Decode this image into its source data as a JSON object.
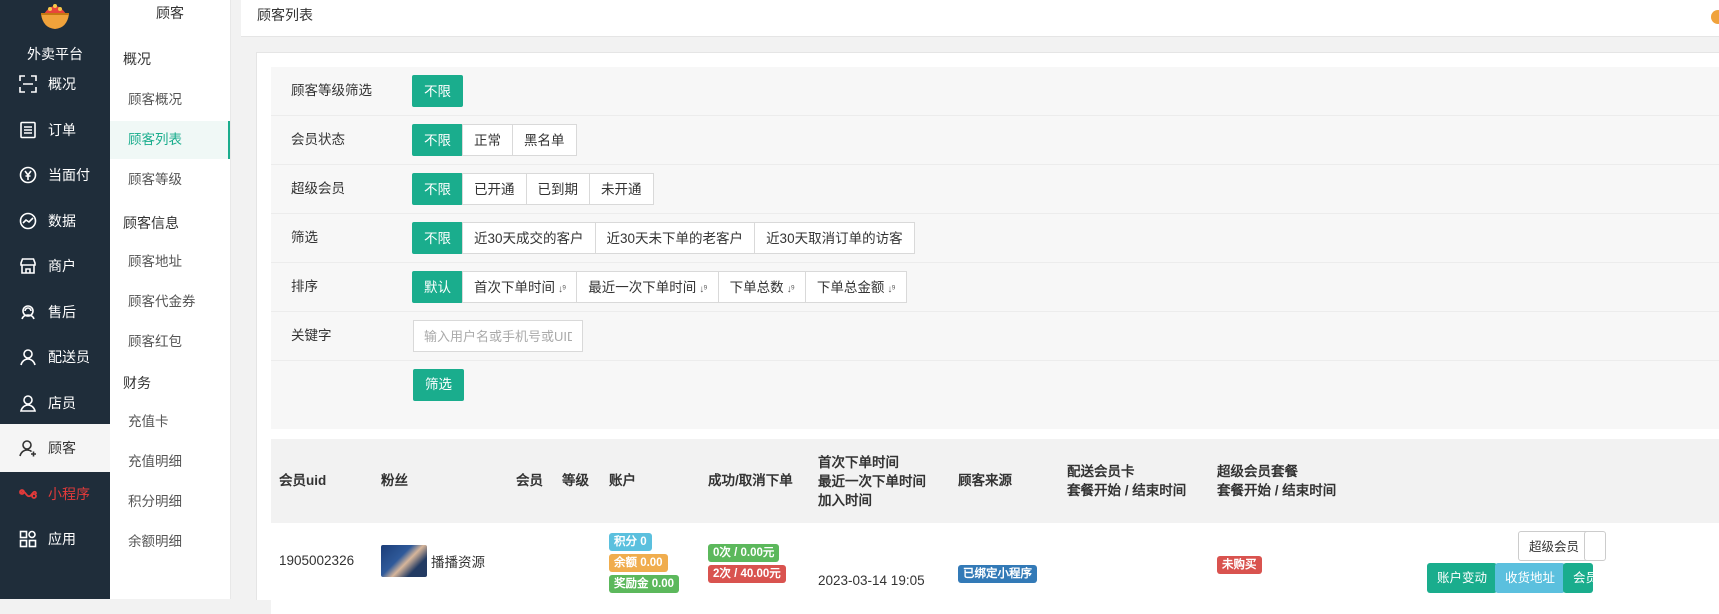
{
  "brand": {
    "name": "外卖平台"
  },
  "nav": [
    {
      "label": "概况",
      "icon": "overview-icon"
    },
    {
      "label": "订单",
      "icon": "order-icon"
    },
    {
      "label": "当面付",
      "icon": "yen-icon"
    },
    {
      "label": "数据",
      "icon": "chart-icon"
    },
    {
      "label": "商户",
      "icon": "store-icon"
    },
    {
      "label": "售后",
      "icon": "support-icon"
    },
    {
      "label": "配送员",
      "icon": "courier-icon"
    },
    {
      "label": "店员",
      "icon": "clerk-icon"
    },
    {
      "label": "顾客",
      "icon": "customer-icon"
    },
    {
      "label": "小程序",
      "icon": "miniprogram-icon"
    },
    {
      "label": "应用",
      "icon": "apps-icon"
    }
  ],
  "sub": {
    "title": "顾客",
    "groups": [
      "概况",
      "顾客信息",
      "财务"
    ],
    "items": [
      "顾客概况",
      "顾客列表",
      "顾客等级",
      "顾客地址",
      "顾客代金券",
      "顾客红包",
      "充值卡",
      "充值明细",
      "积分明细",
      "余额明细"
    ]
  },
  "topbar": {
    "title": "顾客列表"
  },
  "filters": {
    "level": {
      "label": "顾客等级筛选",
      "options": [
        "不限"
      ]
    },
    "status": {
      "label": "会员状态",
      "options": [
        "不限",
        "正常",
        "黑名单"
      ]
    },
    "super": {
      "label": "超级会员",
      "options": [
        "不限",
        "已开通",
        "已到期",
        "未开通"
      ]
    },
    "screen": {
      "label": "筛选",
      "options": [
        "不限",
        "近30天成交的客户",
        "近30天未下单的老客户",
        "近30天取消订单的访客"
      ]
    },
    "sort": {
      "label": "排序",
      "options": [
        "默认",
        "首次下单时间",
        "最近一次下单时间",
        "下单总数",
        "下单总金额"
      ]
    },
    "keyword": {
      "label": "关键字",
      "placeholder": "输入用户名或手机号或UID"
    },
    "submit": "筛选"
  },
  "table": {
    "headers": {
      "uid": "会员uid",
      "fans": "粉丝",
      "member": "会员",
      "level": "等级",
      "account": "账户",
      "success": "成功/取消下单",
      "time1": "首次下单时间",
      "time2": "最近一次下单时间",
      "time3": "加入时间",
      "source": "顾客来源",
      "card1": "配送会员卡",
      "card2": "套餐开始 / 结束时间",
      "pkg1": "超级会员套餐",
      "pkg2": "套餐开始 / 结束时间"
    },
    "row": {
      "uid": "1905002326",
      "name": "播播资源",
      "points": "积分 0",
      "balance": "余额 0.00",
      "bonus": "奖励金 0.00",
      "success": "0次 / 0.00元",
      "cancel": "2次 / 40.00元",
      "time": "2023-03-14 19:05",
      "source": "已绑定小程序",
      "pkg": "未购买",
      "actions": {
        "super": "超级会员",
        "change": "账户变动",
        "address": "收货地址",
        "more": "会员"
      }
    }
  },
  "colors": {
    "accent": "#1aad8d",
    "nav_bg": "#1f2d3a",
    "info": "#5bc0de",
    "warning": "#f0ad4e",
    "success": "#5cb85c",
    "danger": "#d9534f",
    "primary": "#337ab7"
  }
}
